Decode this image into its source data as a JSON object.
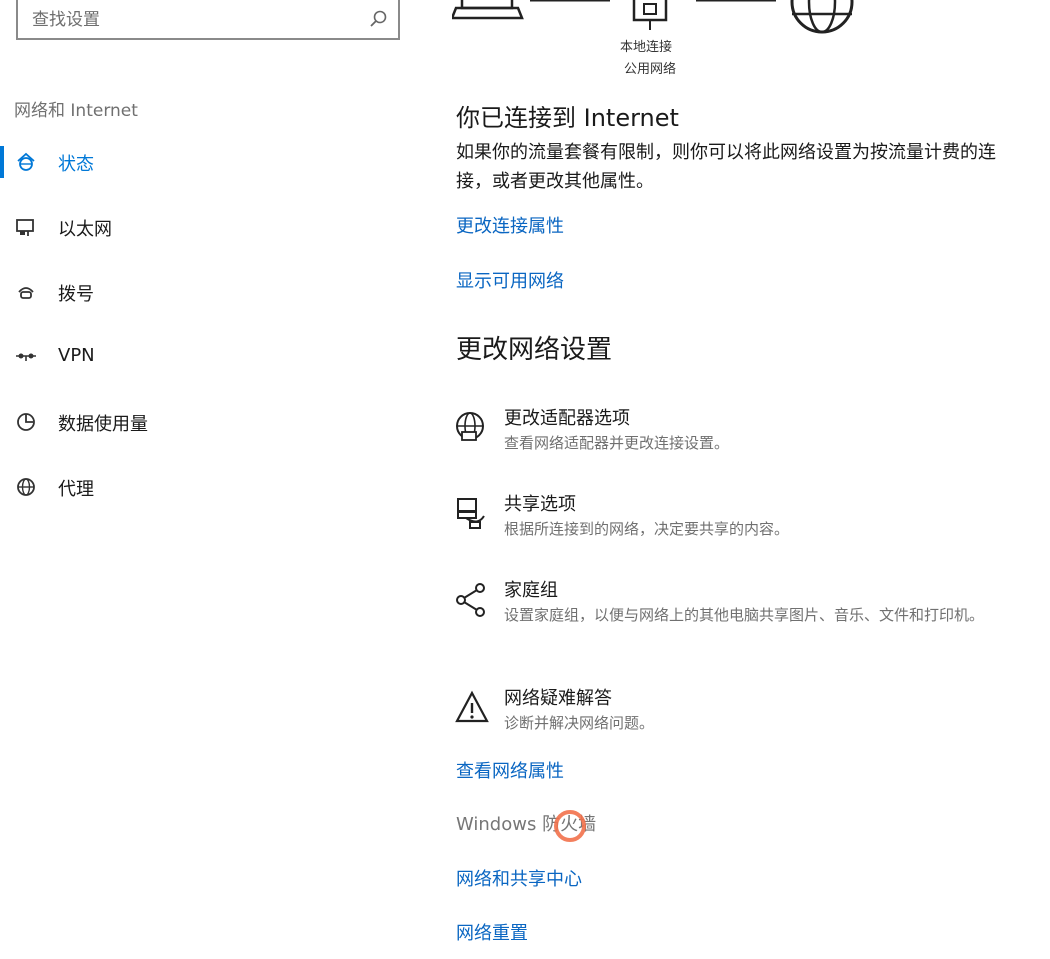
{
  "search": {
    "placeholder": "查找设置"
  },
  "sidebar": {
    "section": "网络和 Internet",
    "items": [
      {
        "label": "状态",
        "icon": "home-globe-icon",
        "active": true
      },
      {
        "label": "以太网",
        "icon": "ethernet-icon"
      },
      {
        "label": "拨号",
        "icon": "dialup-icon"
      },
      {
        "label": "VPN",
        "icon": "vpn-icon"
      },
      {
        "label": "数据使用量",
        "icon": "data-usage-icon"
      },
      {
        "label": "代理",
        "icon": "globe-icon"
      }
    ]
  },
  "diagram": {
    "adapter_name": "本地连接",
    "network_type": "公用网络"
  },
  "main": {
    "connected_heading": "你已连接到 Internet",
    "connected_desc": "如果你的流量套餐有限制，则你可以将此网络设置为按流量计费的连接，或者更改其他属性。",
    "link_change_props": "更改连接属性",
    "link_show_networks": "显示可用网络",
    "change_heading": "更改网络设置",
    "options": [
      {
        "title": "更改适配器选项",
        "desc": "查看网络适配器并更改连接设置。",
        "icon": "adapter-globe-icon"
      },
      {
        "title": "共享选项",
        "desc": "根据所连接到的网络，决定要共享的内容。",
        "icon": "sharing-icon"
      },
      {
        "title": "家庭组",
        "desc": "设置家庭组，以便与网络上的其他电脑共享图片、音乐、文件和打印机。",
        "icon": "homegroup-icon"
      },
      {
        "title": "网络疑难解答",
        "desc": "诊断并解决网络问题。",
        "icon": "warning-icon"
      }
    ],
    "link_view_props": "查看网络属性",
    "firewall": "Windows 防火墙",
    "link_sharing_center": "网络和共享中心",
    "link_reset": "网络重置"
  },
  "colors": {
    "accent": "#0078d7",
    "link": "#0a66c2",
    "secondary_text": "#707070",
    "cursor_ring": "#f2714b"
  }
}
